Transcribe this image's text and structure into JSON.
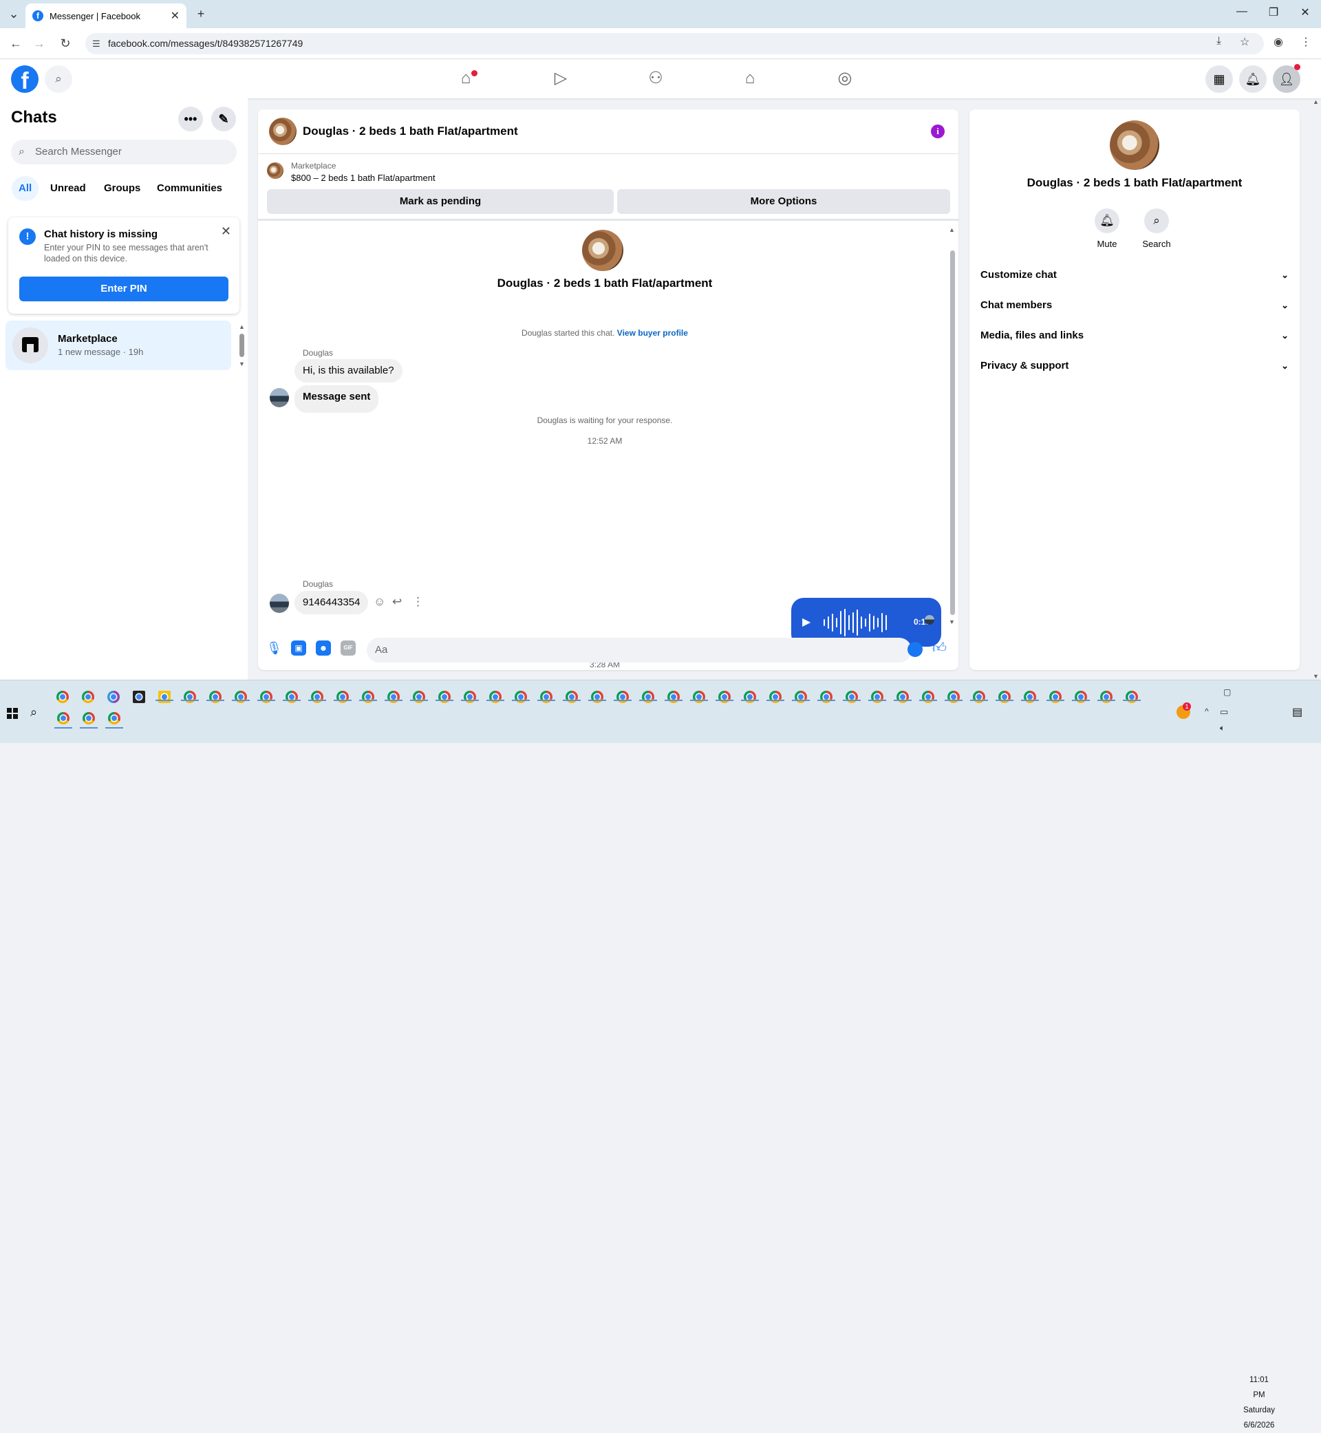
{
  "browser": {
    "tab_title": "Messenger | Facebook",
    "url": "facebook.com/messages/t/849382571267749",
    "new_tab": "+",
    "close_tab": "✕"
  },
  "fb_header": {
    "logo_letter": "f",
    "nav_icons": [
      "home-icon",
      "video-icon",
      "friends-icon",
      "marketplace-icon",
      "gaming-icon"
    ]
  },
  "left_pane": {
    "title": "Chats",
    "more": "•••",
    "compose": "✎",
    "search_placeholder": "Search Messenger",
    "filters": [
      "All",
      "Unread",
      "Groups",
      "Communities"
    ],
    "active_filter": "All",
    "pin_card": {
      "icon": "!",
      "title": "Chat history is missing",
      "body": "Enter your PIN to see messages that aren't loaded on this device.",
      "button": "Enter PIN"
    },
    "conversations": [
      {
        "name": "Marketplace",
        "snippet": "1 new message · 19h"
      }
    ]
  },
  "conversation": {
    "title": "Douglas · 2 beds 1 bath Flat/apartment",
    "info_icon": "i",
    "marketplace_label": "Marketplace",
    "listing": "$800 – 2 beds 1 bath Flat/apartment",
    "buttons": [
      "Mark as pending",
      "More Options"
    ],
    "thread_title": "Douglas · 2 beds 1 bath Flat/apartment",
    "started_text": "Douglas started this chat.",
    "view_profile": "View buyer profile",
    "messages": [
      {
        "sender": "Douglas",
        "text": "Hi, is this available?"
      },
      {
        "sender": "",
        "text": "Message sent"
      }
    ],
    "waiting_text": "Douglas is waiting for your response.",
    "time1": "12:52 AM",
    "voice_duration": "0:10",
    "time2": "3:28 AM",
    "last_sender": "Douglas",
    "last_message": "9146443354",
    "composer_placeholder": "Aa"
  },
  "right_pane": {
    "name": "Douglas · 2 beds 1 bath Flat/apartment",
    "actions": [
      "Mute",
      "Search"
    ],
    "sections": [
      "Customize chat",
      "Chat members",
      "Media, files and links",
      "Privacy & support"
    ]
  },
  "taskbar": {
    "time": "11:01 PM",
    "day": "Saturday",
    "date": "6/6/2026",
    "notification_badge": "1"
  },
  "colors": {
    "accent": "#1877f2",
    "voice_bubble": "#1f5ad7",
    "info": "#9b19d1",
    "notification": "#e41e3f"
  }
}
